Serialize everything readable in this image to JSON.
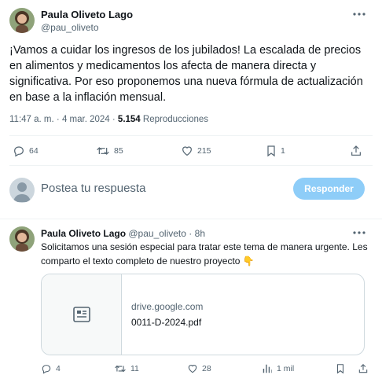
{
  "main_tweet": {
    "author_name": "Paula Oliveto Lago",
    "author_handle": "@pau_oliveto",
    "more_icon": "more-dots-icon",
    "text": "¡Vamos a cuidar los ingresos de los jubilados! La escalada de precios en alimentos y medicamentos los afecta de manera directa y significativa. Por eso proponemos una nueva fórmula de actualización en base a la inflación mensual.",
    "time": "11:47 a. m.",
    "separator": "·",
    "date": "4 mar. 2024",
    "views_count": "5.154",
    "views_label": "Reproducciones",
    "actions": {
      "reply_count": "64",
      "retweet_count": "85",
      "like_count": "215",
      "bookmark_count": "1"
    }
  },
  "compose": {
    "placeholder": "Postea tu respuesta",
    "button_label": "Responder"
  },
  "reply_tweet": {
    "author_name": "Paula Oliveto Lago",
    "author_handle": "@pau_oliveto",
    "separator": "·",
    "time_ago": "8h",
    "text": "Solicitamos una sesión especial para tratar este tema de manera urgente. Les comparto el texto completo de nuestro proyecto 👇",
    "card": {
      "domain": "drive.google.com",
      "title": "0011-D-2024.pdf",
      "icon": "document-icon"
    },
    "actions": {
      "reply_count": "4",
      "retweet_count": "11",
      "like_count": "28",
      "views_count": "1 mil"
    }
  },
  "colors": {
    "accent": "#1d9bf0",
    "reply_button_disabled": "#8ecdf8",
    "secondary_text": "#536471",
    "primary_text": "#0f1419",
    "divider": "#eff3f4"
  }
}
